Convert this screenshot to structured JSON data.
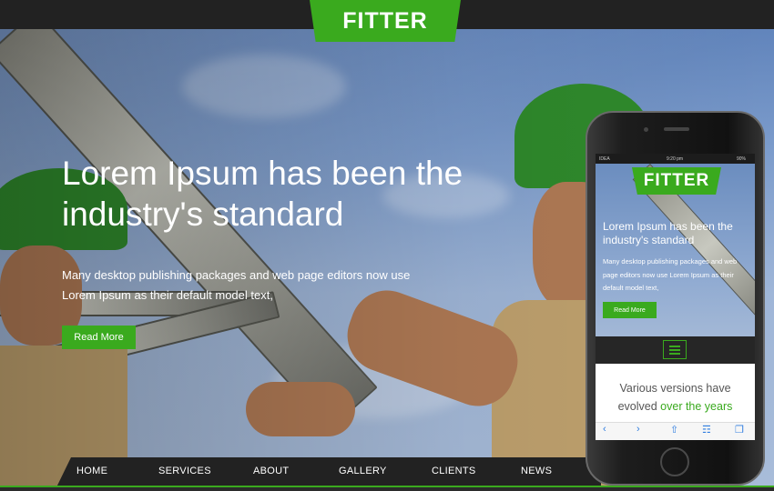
{
  "brand": {
    "logo": "FITTER",
    "accent_color": "#3aaa1e"
  },
  "hero": {
    "headline": "Lorem Ipsum has been the industry's standard",
    "subtext": "Many desktop publishing packages and web page editors now use Lorem Ipsum as their default model text,",
    "cta_label": "Read More"
  },
  "nav": {
    "items": [
      {
        "label": "HOME"
      },
      {
        "label": "SERVICES"
      },
      {
        "label": "ABOUT"
      },
      {
        "label": "GALLERY"
      },
      {
        "label": "CLIENTS"
      },
      {
        "label": "NEWS"
      }
    ]
  },
  "phone": {
    "status": {
      "carrier": "IDEA",
      "time": "9:20 pm",
      "battery": "90%"
    },
    "logo": "FITTER",
    "headline": "Lorem Ipsum has been the industry's standard",
    "subtext": "Many desktop publishing packages and web page editors now use Lorem Ipsum as their default model text,",
    "cta_label": "Read More",
    "versions_text_1": "Various versions have",
    "versions_text_2": "evolved",
    "versions_highlight": "over the years",
    "toolbar_icons": [
      "back-icon",
      "forward-icon",
      "share-icon",
      "bookmarks-icon",
      "tabs-icon"
    ]
  }
}
